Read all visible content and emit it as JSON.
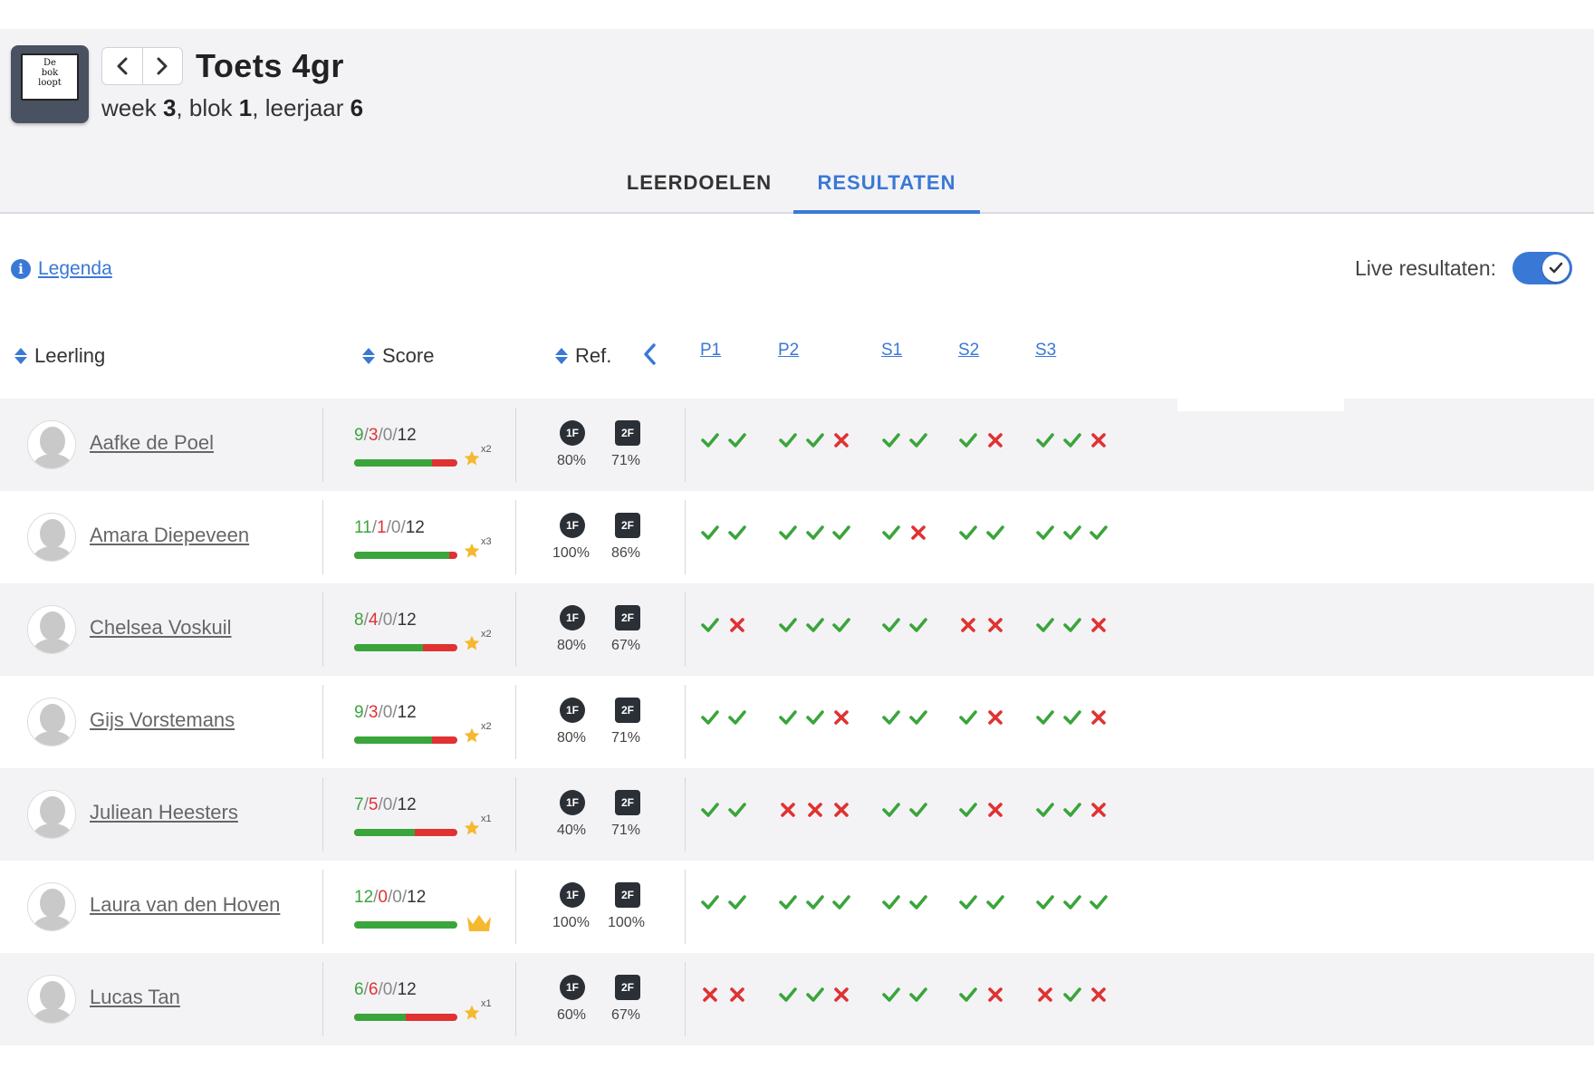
{
  "logo": {
    "line1": "De",
    "line2": "bok",
    "line3": "loopt"
  },
  "header": {
    "title": "Toets 4gr",
    "subtitle_week_label": "week",
    "subtitle_week": "3",
    "subtitle_blok_label": "blok",
    "subtitle_blok": "1",
    "subtitle_leerjaar_label": "leerjaar",
    "subtitle_leerjaar": "6"
  },
  "tabs": [
    {
      "label": "LEERDOELEN",
      "active": false
    },
    {
      "label": "RESULTATEN",
      "active": true
    }
  ],
  "legend_link": "Legenda",
  "live_results": {
    "label": "Live resultaten:",
    "enabled": true
  },
  "columns": {
    "leerling": "Leerling",
    "score": "Score",
    "ref": "Ref.",
    "goals": [
      "P1",
      "P2",
      "S1",
      "S2",
      "S3"
    ]
  },
  "colors": {
    "accent": "#3a78d6",
    "correct": "#3aa53a",
    "wrong": "#e03232",
    "row_alt": "#f3f3f6",
    "badge": "#2b2f36",
    "star": "#f5b82e"
  },
  "students": [
    {
      "name": "Aafke de Poel",
      "correct": "9",
      "wrong": "3",
      "skipped": "0",
      "total": "12",
      "reward": "star",
      "multiplier": "x2",
      "ref1f_label": "1F",
      "ref1f_pct": "80%",
      "ref2f_label": "2F",
      "ref2f_pct": "71%",
      "results": {
        "P1": [
          1,
          1
        ],
        "P2": [
          1,
          1,
          0
        ],
        "S1": [
          1,
          1
        ],
        "S2": [
          1,
          0
        ],
        "S3": [
          1,
          1,
          0
        ]
      }
    },
    {
      "name": "Amara Diepeveen",
      "correct": "11",
      "wrong": "1",
      "skipped": "0",
      "total": "12",
      "reward": "star",
      "multiplier": "x3",
      "ref1f_label": "1F",
      "ref1f_pct": "100%",
      "ref2f_label": "2F",
      "ref2f_pct": "86%",
      "results": {
        "P1": [
          1,
          1
        ],
        "P2": [
          1,
          1,
          1
        ],
        "S1": [
          1,
          0
        ],
        "S2": [
          1,
          1
        ],
        "S3": [
          1,
          1,
          1
        ]
      }
    },
    {
      "name": "Chelsea Voskuil",
      "correct": "8",
      "wrong": "4",
      "skipped": "0",
      "total": "12",
      "reward": "star",
      "multiplier": "x2",
      "ref1f_label": "1F",
      "ref1f_pct": "80%",
      "ref2f_label": "2F",
      "ref2f_pct": "67%",
      "results": {
        "P1": [
          1,
          0
        ],
        "P2": [
          1,
          1,
          1
        ],
        "S1": [
          1,
          1
        ],
        "S2": [
          0,
          0
        ],
        "S3": [
          1,
          1,
          0
        ]
      }
    },
    {
      "name": "Gijs Vorstemans",
      "correct": "9",
      "wrong": "3",
      "skipped": "0",
      "total": "12",
      "reward": "star",
      "multiplier": "x2",
      "ref1f_label": "1F",
      "ref1f_pct": "80%",
      "ref2f_label": "2F",
      "ref2f_pct": "71%",
      "results": {
        "P1": [
          1,
          1
        ],
        "P2": [
          1,
          1,
          0
        ],
        "S1": [
          1,
          1
        ],
        "S2": [
          1,
          0
        ],
        "S3": [
          1,
          1,
          0
        ]
      }
    },
    {
      "name": "Juliean Heesters",
      "correct": "7",
      "wrong": "5",
      "skipped": "0",
      "total": "12",
      "reward": "star",
      "multiplier": "x1",
      "ref1f_label": "1F",
      "ref1f_pct": "40%",
      "ref2f_label": "2F",
      "ref2f_pct": "71%",
      "results": {
        "P1": [
          1,
          1
        ],
        "P2": [
          0,
          0,
          0
        ],
        "S1": [
          1,
          1
        ],
        "S2": [
          1,
          0
        ],
        "S3": [
          1,
          1,
          0
        ]
      }
    },
    {
      "name": "Laura van den Hoven",
      "correct": "12",
      "wrong": "0",
      "skipped": "0",
      "total": "12",
      "reward": "crown",
      "multiplier": "",
      "ref1f_label": "1F",
      "ref1f_pct": "100%",
      "ref2f_label": "2F",
      "ref2f_pct": "100%",
      "results": {
        "P1": [
          1,
          1
        ],
        "P2": [
          1,
          1,
          1
        ],
        "S1": [
          1,
          1
        ],
        "S2": [
          1,
          1
        ],
        "S3": [
          1,
          1,
          1
        ]
      }
    },
    {
      "name": "Lucas Tan",
      "correct": "6",
      "wrong": "6",
      "skipped": "0",
      "total": "12",
      "reward": "star",
      "multiplier": "x1",
      "ref1f_label": "1F",
      "ref1f_pct": "60%",
      "ref2f_label": "2F",
      "ref2f_pct": "67%",
      "results": {
        "P1": [
          0,
          0
        ],
        "P2": [
          1,
          1,
          0
        ],
        "S1": [
          1,
          1
        ],
        "S2": [
          1,
          0
        ],
        "S3": [
          0,
          1,
          0
        ]
      }
    }
  ]
}
